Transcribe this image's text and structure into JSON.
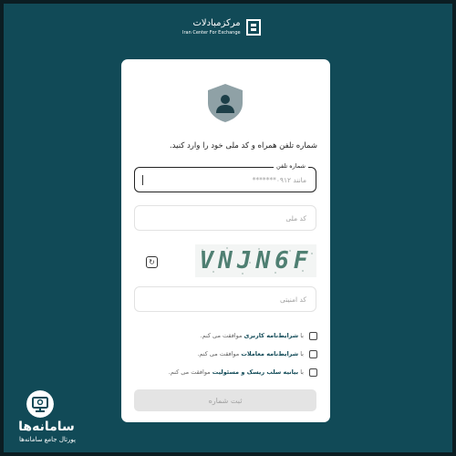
{
  "header": {
    "logo_fa": "مرکزمبادلات",
    "logo_en": "Iran Center For Exchange"
  },
  "form": {
    "instruction": "شماره تلفن همراه و کد ملی خود را وارد کنید.",
    "phone": {
      "label": "شماره تلفن",
      "placeholder": "مانند ۰۹۱۲*******"
    },
    "national_id": {
      "placeholder": "کد ملی"
    },
    "captcha": {
      "text": "VNJN6F"
    },
    "security_code": {
      "placeholder": "کد امنیتی"
    },
    "checks": [
      {
        "prefix": "با",
        "link": "شرایط‌نامه کاربری",
        "suffix": "موافقت می کنم."
      },
      {
        "prefix": "با",
        "link": "شرایط‌نامه معاملات",
        "suffix": "موافقت می کنم."
      },
      {
        "prefix": "با",
        "link": "بیانیه سلب ریسک و مسئولیت",
        "suffix": "موافقت می کنم."
      }
    ],
    "submit_label": "ثبت شماره"
  },
  "watermark": {
    "title": "سامانه‌ها",
    "subtitle": "پورتال جامع سامانه‌ها"
  },
  "colors": {
    "background": "#114a57",
    "accent": "#114a57",
    "shield": "#8fa1a6"
  }
}
